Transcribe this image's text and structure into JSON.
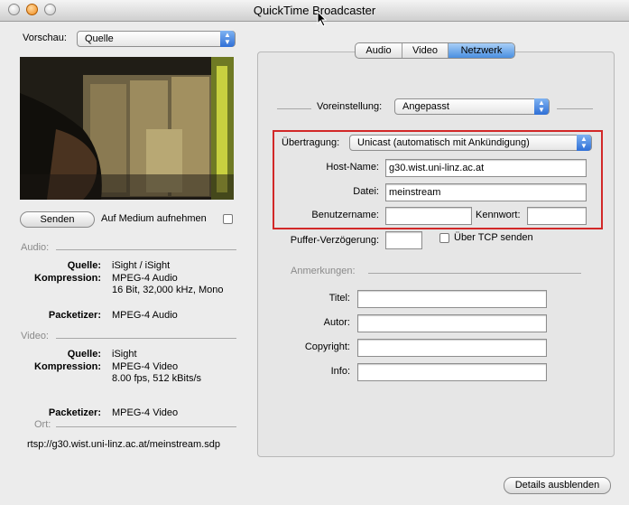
{
  "window": {
    "title": "QuickTime Broadcaster"
  },
  "preview": {
    "label": "Vorschau:",
    "value": "Quelle"
  },
  "actions": {
    "send": "Senden",
    "record_label": "Auf Medium aufnehmen",
    "details": "Details ausblenden"
  },
  "audio": {
    "header": "Audio:",
    "source_label": "Quelle:",
    "source_value": "iSight / iSight",
    "compression_label": "Kompression:",
    "compression_value": "MPEG-4 Audio",
    "compression_detail": "16 Bit, 32,000 kHz, Mono",
    "packetizer_label": "Packetizer:",
    "packetizer_value": "MPEG-4 Audio"
  },
  "video": {
    "header": "Video:",
    "source_label": "Quelle:",
    "source_value": "iSight",
    "compression_label": "Kompression:",
    "compression_value": "MPEG-4 Video",
    "compression_detail": "8.00 fps, 512 kBits/s",
    "packetizer_label": "Packetizer:",
    "packetizer_value": "MPEG-4 Video"
  },
  "location": {
    "header": "Ort:",
    "url": "rtsp://g30.wist.uni-linz.ac.at/meinstream.sdp"
  },
  "tabs": [
    {
      "label": "Audio"
    },
    {
      "label": "Video"
    },
    {
      "label": "Netzwerk"
    }
  ],
  "network": {
    "preset_label": "Voreinstellung:",
    "preset_value": "Angepasst",
    "transmission_label": "Übertragung:",
    "transmission_value": "Unicast (automatisch mit Ankündigung)",
    "host_label": "Host-Name:",
    "host_value": "g30.wist.uni-linz.ac.at",
    "file_label": "Datei:",
    "file_value": "meinstream",
    "user_label": "Benutzername:",
    "user_value": "",
    "password_label": "Kennwort:",
    "password_value": "",
    "buffer_label": "Puffer-Verzögerung:",
    "buffer_value": "",
    "tcp_label": "Über TCP senden"
  },
  "annotations": {
    "header": "Anmerkungen:",
    "title_label": "Titel:",
    "title_value": "",
    "author_label": "Autor:",
    "author_value": "",
    "copyright_label": "Copyright:",
    "copyright_value": "",
    "info_label": "Info:",
    "info_value": ""
  },
  "colors": {
    "highlight_box": "#d22828",
    "selected_tab": "#4a8fe0",
    "popup_arrows": "#2f6fd6"
  }
}
